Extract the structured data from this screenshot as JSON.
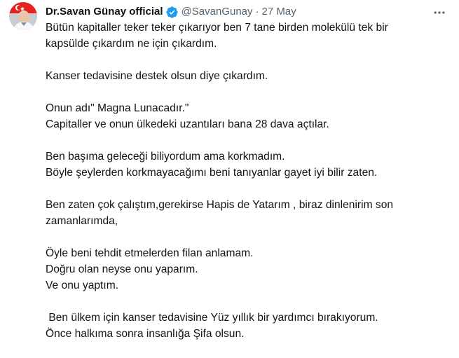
{
  "author": {
    "display_name": "Dr.Savan Günay official",
    "handle": "@SavanGunay",
    "separator": "·",
    "date": "27 May",
    "verified_icon": "verified-badge-icon",
    "accent_color": "#1d9bf0"
  },
  "more_icon": "more-horizontal-icon",
  "tweet": {
    "paragraphs": [
      [
        "Bütün kapitaller teker teker çıkarıyor ben 7 tane birden molekülü tek bir",
        "kapsülde çıkardım ne için çıkardım."
      ],
      [
        "Kanser tedavisine destek olsun diye çıkardım."
      ],
      [
        "Onun adı\" Magna Lunacadır.\"",
        "Capitaller ve onun ülkedeki uzantıları bana 28 dava açtılar."
      ],
      [
        "Ben başıma geleceği biliyordum ama korkmadım.",
        "Böyle şeylerden korkmayacağımı beni tanıyanlar gayet iyi bilir zaten."
      ],
      [
        "Ben zaten çok çalıştım,gerekirse Hapis de Yatarım , biraz dinlenirim son",
        "zamanlarımda,"
      ],
      [
        "Öyle beni tehdit etmelerden filan anlamam.",
        "Doğru olan neyse onu yaparım.",
        "Ve onu yaptım."
      ],
      [
        " Ben ülkem için kanser tedavisine Yüz yıllık bir yardımcı bırakıyorum.",
        "Önce halkıma sonra insanlığa Şifa olsun."
      ]
    ]
  }
}
